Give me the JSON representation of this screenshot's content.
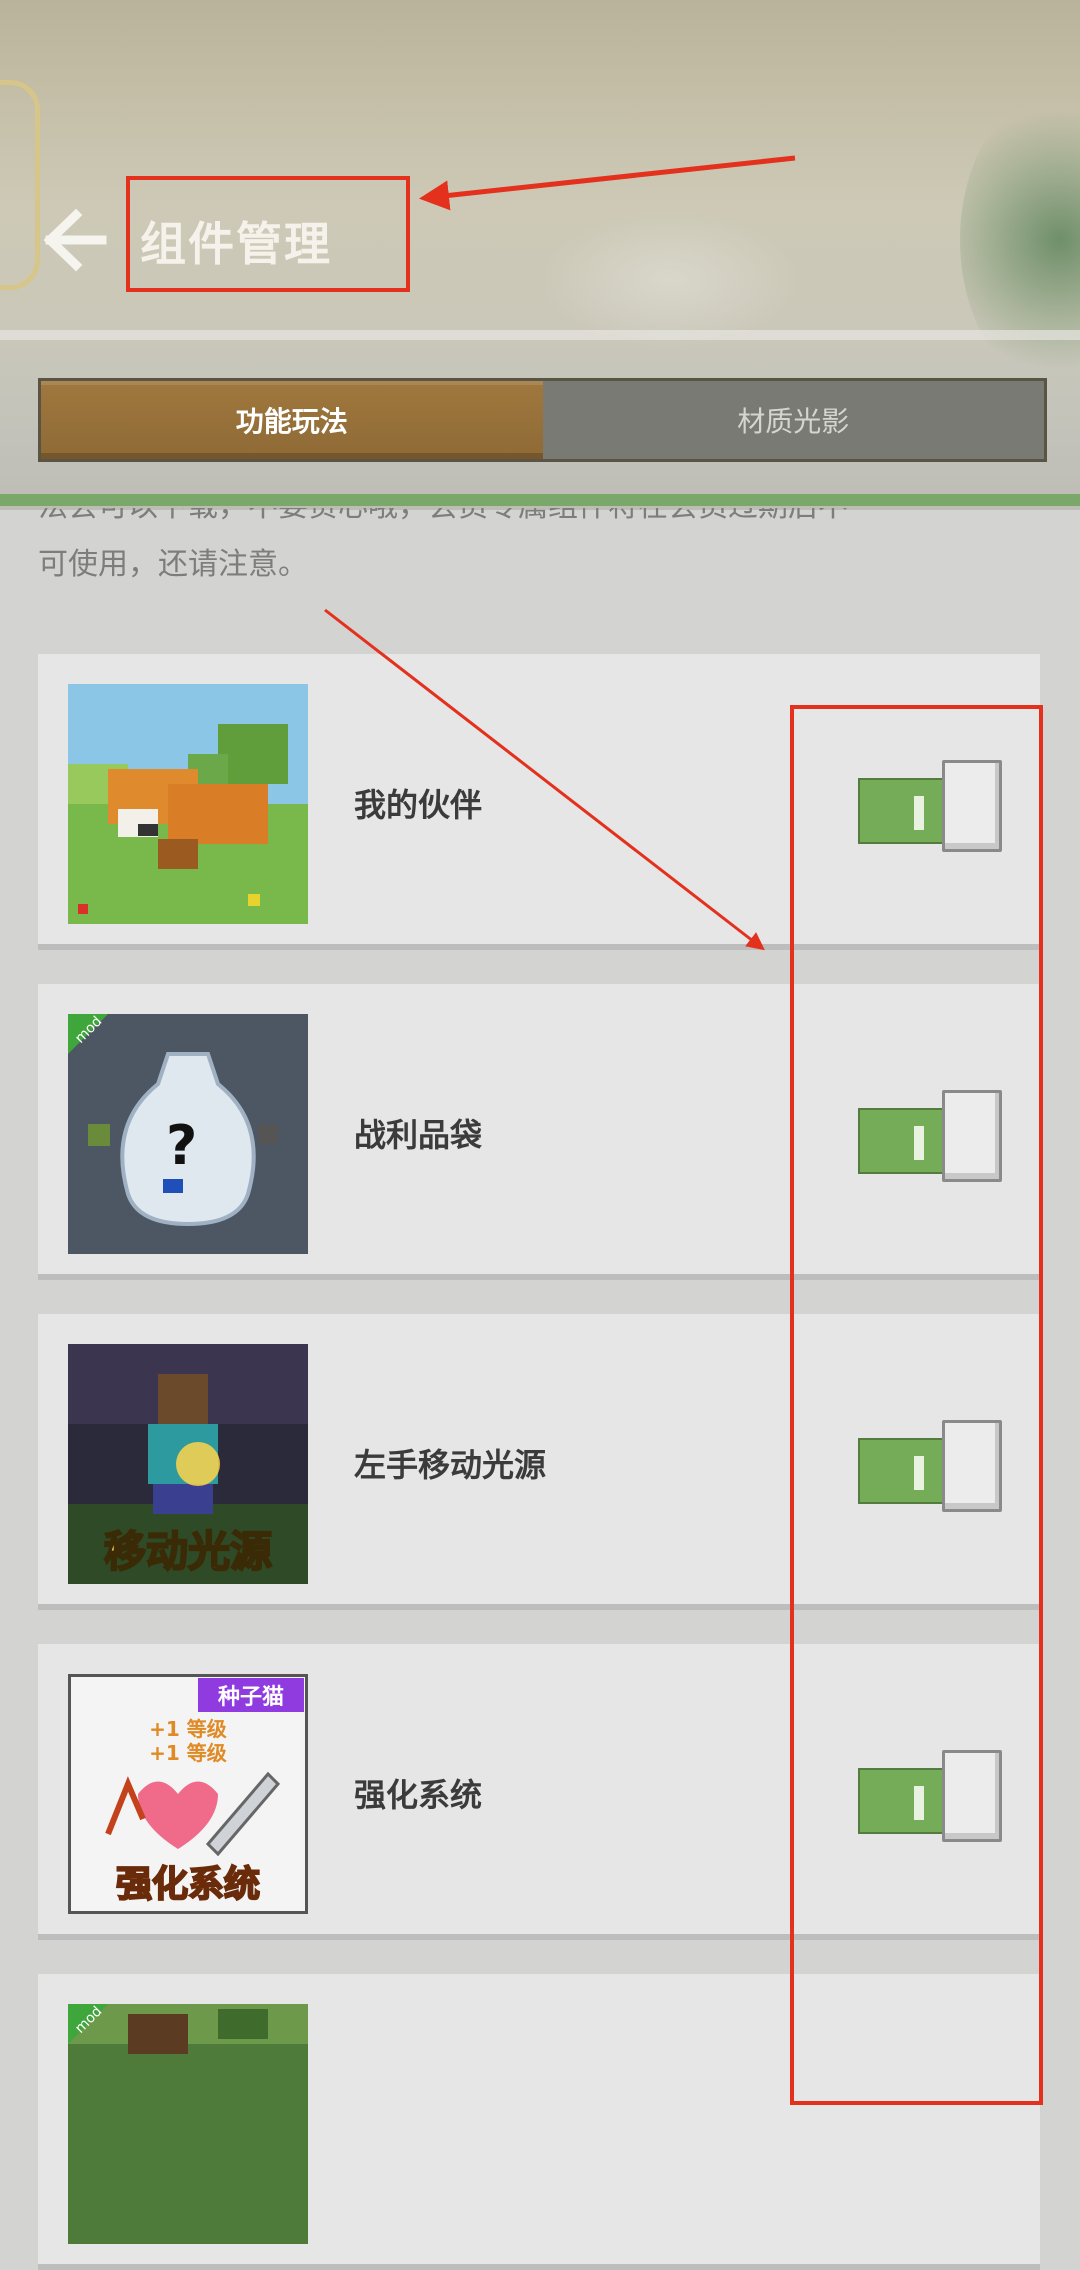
{
  "header": {
    "title": "组件管理",
    "back_icon": "arrow-left-icon"
  },
  "tabs": [
    {
      "label": "功能玩法",
      "active": true
    },
    {
      "label": "材质光影",
      "active": false
    }
  ],
  "notice": {
    "line1_partial": "法会可以下载，不要贪心哦，会员专属组件将在会员过期后不",
    "line2": "可使用，还请注意。"
  },
  "items": [
    {
      "label": "我的伙伴",
      "enabled": true,
      "thumb": "fox-thumbnail"
    },
    {
      "label": "战利品袋",
      "enabled": true,
      "thumb": "loot-bag-thumbnail",
      "corner_badge": "mod"
    },
    {
      "label": "左手移动光源",
      "enabled": true,
      "thumb": "torch-thumbnail",
      "thumb_text": "移动光源"
    },
    {
      "label": "强化系统",
      "enabled": true,
      "thumb": "enhance-thumbnail",
      "thumb_top_badge": "种子猫",
      "thumb_line1": "+1 等级",
      "thumb_line2": "+1 等级",
      "thumb_text": "强化系统"
    },
    {
      "label": "",
      "enabled": true,
      "thumb": "landscape-thumbnail",
      "corner_badge": "mod"
    }
  ],
  "colors": {
    "annotation_red": "#e3311d",
    "toggle_on": "#75ac57",
    "tab_active": "#9a7339"
  }
}
